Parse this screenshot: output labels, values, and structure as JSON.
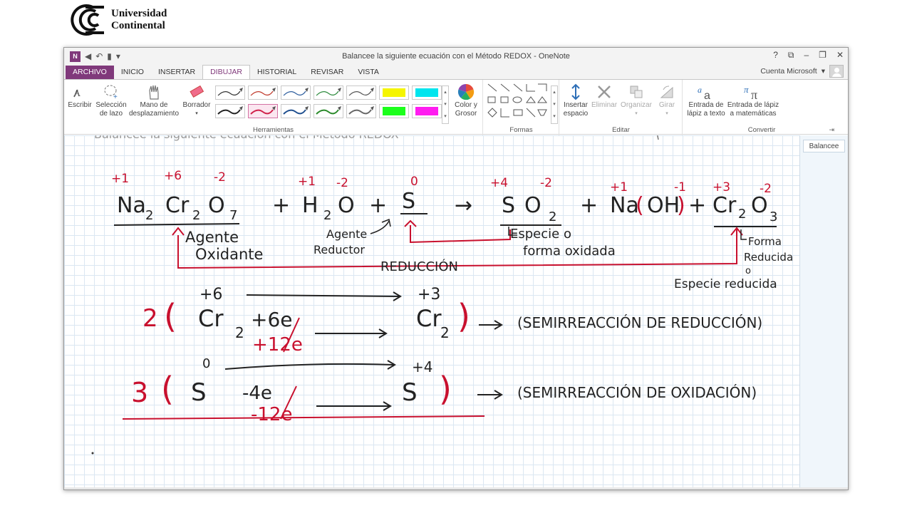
{
  "logo": {
    "line1": "Universidad",
    "line2": "Continental"
  },
  "window": {
    "title": "Balancee la siguiente ecuación con el Método REDOX - OneNote",
    "controls": {
      "help": "?",
      "restore_ribbon": "⧉",
      "minimize": "–",
      "maximize": "❐",
      "close": "✕"
    }
  },
  "qat": {
    "onenote": "N",
    "back": "◀",
    "undo": "↶",
    "dock": "▮",
    "more": "▾"
  },
  "tabs": [
    {
      "label": "ARCHIVO"
    },
    {
      "label": "INICIO"
    },
    {
      "label": "INSERTAR"
    },
    {
      "label": "DIBUJAR"
    },
    {
      "label": "HISTORIAL"
    },
    {
      "label": "REVISAR"
    },
    {
      "label": "VISTA"
    }
  ],
  "account": {
    "label": "Cuenta Microsoft",
    "caret": "▾"
  },
  "ribbon": {
    "herramientas": {
      "label": "Herramientas",
      "escribir": "Escribir",
      "seleccion1": "Selección",
      "seleccion2": "de lazo",
      "mano1": "Mano de",
      "mano2": "desplazamiento",
      "borrador": "Borrador",
      "color1": "Color y",
      "color2": "Grosor"
    },
    "formas": {
      "label": "Formas"
    },
    "editar": {
      "label": "Editar",
      "insertar1": "Insertar",
      "insertar2": "espacio",
      "eliminar": "Eliminar",
      "organizar": "Organizar",
      "girar": "Girar"
    },
    "convertir": {
      "label": "Convertir",
      "texto1": "Entrada de",
      "texto2": "lápiz a texto",
      "mate1": "Entrada de lápiz",
      "mate2": "a matemáticas"
    },
    "pen_colors": [
      "#333333",
      "#c0392b",
      "#2e5e9e",
      "#2e8b3e",
      "#555555",
      "#f5f500",
      "#00e5ee",
      "#222222",
      "#d0204a",
      "#1f4f8f",
      "#2a8a2a",
      "#666666",
      "#1cff1c",
      "#ff1cf0"
    ]
  },
  "page": {
    "tab_label": "Balancee",
    "header_text": "Balancee la siguiente ecuación con el Método REDOX",
    "equation": [
      "Na",
      "2",
      "Cr",
      "2",
      "O",
      "7",
      "+",
      "H",
      "2",
      "O",
      "+",
      "S",
      "→",
      "S",
      "O",
      "2",
      "+",
      "Na",
      "(",
      "OH",
      ")",
      "+",
      "Cr",
      "2",
      "O",
      "3"
    ],
    "oxidation_states": [
      "+1",
      "+6",
      "-2",
      "+1",
      "-2",
      "0",
      "+4",
      "-2",
      "+1",
      "-1",
      "+3",
      "-2"
    ],
    "notes": {
      "agente_ox1": "Agente",
      "agente_ox2": "Oxidante",
      "agente_red1": "Agente",
      "agente_red2": "Reductor",
      "especie1": "Especie o",
      "especie2": "forma oxidada",
      "forma1": "Forma",
      "forma2": "Reducida",
      "especie_red": "Especie reducida",
      "reduccion": "REDUCCIÓN"
    },
    "half1": {
      "coef": "2",
      "lhs": "Cr",
      "sub": "2",
      "e": "+6e",
      "ox_left": "+6",
      "ox_right": "+3",
      "rhs": "Cr",
      "rhs_sub": "2",
      "mult": "+12e",
      "label": "(SEMIRREACCIÓN DE REDUCCIÓN)"
    },
    "half2": {
      "coef": "3",
      "lhs": "S",
      "e": "-4e",
      "ox_left": "0",
      "ox_right": "+4",
      "rhs": "S",
      "mult": "-12e",
      "label": "(SEMIRREACCIÓN DE OXIDACIÓN)"
    }
  }
}
